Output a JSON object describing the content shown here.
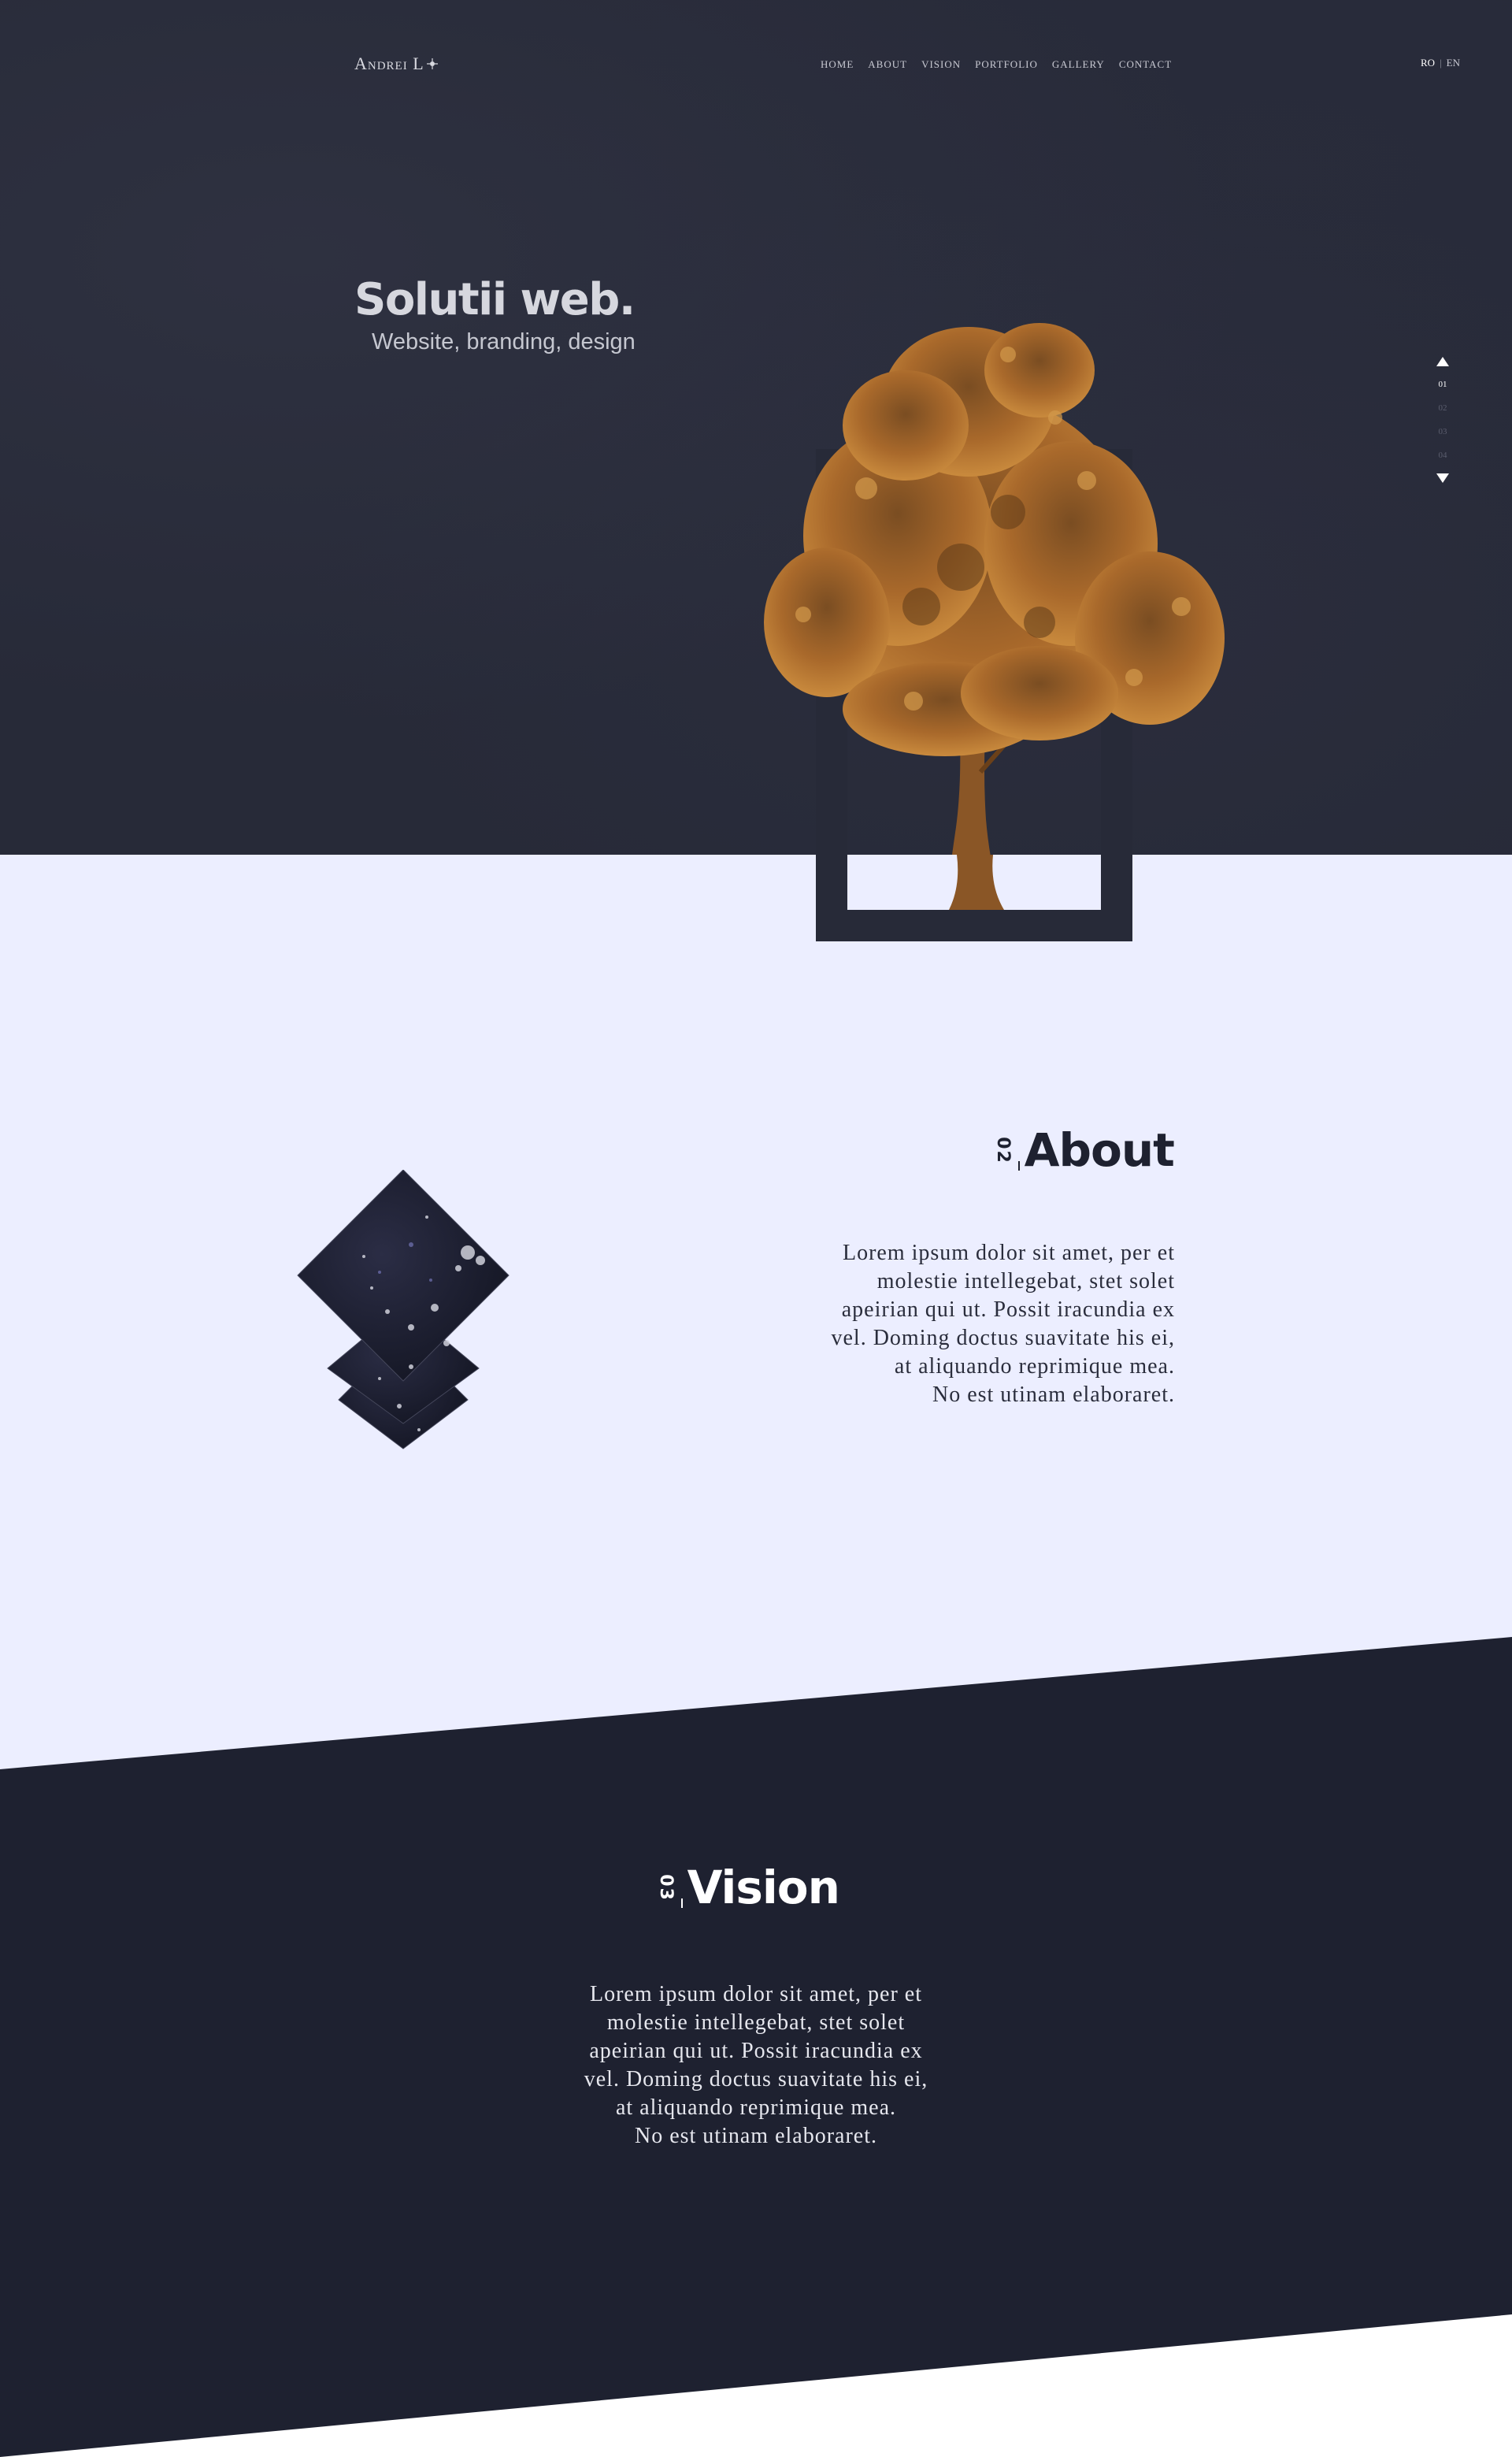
{
  "brand": {
    "name": "Andrei L"
  },
  "nav": {
    "items": [
      {
        "label": "HOME"
      },
      {
        "label": "ABOUT"
      },
      {
        "label": "VISION"
      },
      {
        "label": "PORTFOLIO"
      },
      {
        "label": "GALLERY"
      },
      {
        "label": "CONTACT"
      }
    ]
  },
  "lang": {
    "active": "RO",
    "separator": "|",
    "other": "EN"
  },
  "hero": {
    "title": "Solutii web.",
    "subtitle": "Website, branding, design"
  },
  "slider": {
    "pages": [
      "01",
      "02",
      "03",
      "04"
    ],
    "active_index": 0
  },
  "about": {
    "number": "02",
    "title": "About",
    "text": "Lorem ipsum dolor sit amet, per et\nmolestie intellegebat, stet solet\napeirian qui ut. Possit iracundia ex\nvel. Doming doctus suavitate his ei,\nat aliquando reprimique mea.\nNo est utinam elaboraret."
  },
  "vision": {
    "number": "03",
    "title": "Vision",
    "text": "Lorem ipsum dolor sit amet, per et\nmolestie intellegebat, stet solet\napeirian qui ut. Possit iracundia ex\nvel. Doming doctus suavitate his ei,\nat aliquando reprimique mea.\nNo est utinam elaboraret."
  },
  "colors": {
    "hero_bg": "#272a38",
    "light_bg": "#eceeff",
    "dark_bg": "#1e2130",
    "tree_foliage": "#b8772f",
    "tree_trunk": "#8a5626"
  }
}
